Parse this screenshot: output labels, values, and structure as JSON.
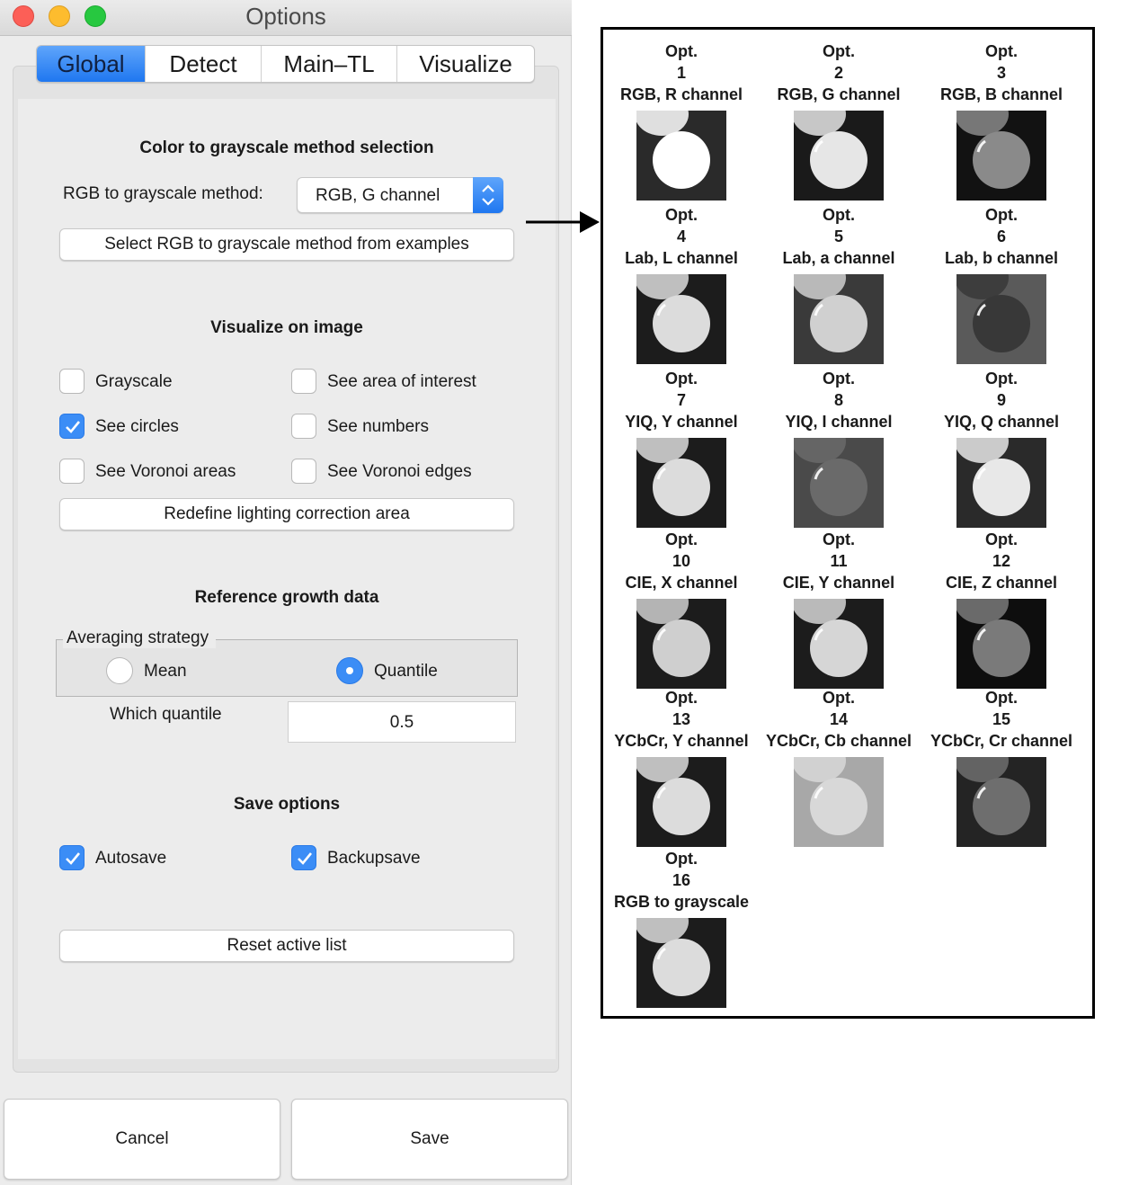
{
  "window": {
    "title": "Options",
    "tabs": [
      "Global",
      "Detect",
      "Main–TL",
      "Visualize"
    ],
    "active_tab": "Global"
  },
  "color_section": {
    "title": "Color to grayscale method selection",
    "method_label": "RGB to grayscale method:",
    "method_value": "RGB, G channel",
    "examples_button": "Select RGB to grayscale method from examples"
  },
  "visualize_section": {
    "title": "Visualize on image",
    "checkboxes": [
      {
        "label": "Grayscale",
        "checked": false
      },
      {
        "label": "See area of interest",
        "checked": false
      },
      {
        "label": "See circles",
        "checked": true
      },
      {
        "label": "See numbers",
        "checked": false
      },
      {
        "label": "See Voronoi areas",
        "checked": false
      },
      {
        "label": "See Voronoi edges",
        "checked": false
      }
    ],
    "lighting_button": "Redefine lighting correction area"
  },
  "reference_section": {
    "title": "Reference growth data",
    "group_label": "Averaging strategy",
    "radio_mean": "Mean",
    "radio_quantile": "Quantile",
    "selected": "Quantile",
    "quantile_label": "Which quantile",
    "quantile_value": "0.5"
  },
  "save_section": {
    "title": "Save options",
    "autosave": {
      "label": "Autosave",
      "checked": true
    },
    "backupsave": {
      "label": "Backupsave",
      "checked": true
    },
    "reset_button": "Reset active list"
  },
  "footer": {
    "cancel": "Cancel",
    "save": "Save"
  },
  "examples": [
    {
      "opt": "Opt.",
      "num": "1",
      "name": "RGB, R channel",
      "bg": "#2a2a2a",
      "fg": "#ffffff"
    },
    {
      "opt": "Opt.",
      "num": "2",
      "name": "RGB, G channel",
      "bg": "#1a1a1a",
      "fg": "#e6e6e6"
    },
    {
      "opt": "Opt.",
      "num": "3",
      "name": "RGB, B channel",
      "bg": "#121212",
      "fg": "#8a8a8a"
    },
    {
      "opt": "Opt.",
      "num": "4",
      "name": "Lab, L channel",
      "bg": "#1c1c1c",
      "fg": "#dcdcdc"
    },
    {
      "opt": "Opt.",
      "num": "5",
      "name": "Lab, a channel",
      "bg": "#3a3a3a",
      "fg": "#d0d0d0"
    },
    {
      "opt": "Opt.",
      "num": "6",
      "name": "Lab, b channel",
      "bg": "#5a5a5a",
      "fg": "#383838"
    },
    {
      "opt": "Opt.",
      "num": "7",
      "name": "YIQ, Y channel",
      "bg": "#1c1c1c",
      "fg": "#dcdcdc"
    },
    {
      "opt": "Opt.",
      "num": "8",
      "name": "YIQ, I channel",
      "bg": "#4a4a4a",
      "fg": "#6a6a6a"
    },
    {
      "opt": "Opt.",
      "num": "9",
      "name": "YIQ, Q channel",
      "bg": "#2a2a2a",
      "fg": "#e8e8e8"
    },
    {
      "opt": "Opt.",
      "num": "10",
      "name": "CIE, X channel",
      "bg": "#1c1c1c",
      "fg": "#cfcfcf"
    },
    {
      "opt": "Opt.",
      "num": "11",
      "name": "CIE, Y channel",
      "bg": "#1c1c1c",
      "fg": "#d6d6d6"
    },
    {
      "opt": "Opt.",
      "num": "12",
      "name": "CIE, Z channel",
      "bg": "#0e0e0e",
      "fg": "#7a7a7a"
    },
    {
      "opt": "Opt.",
      "num": "13",
      "name": "YCbCr, Y channel",
      "bg": "#1c1c1c",
      "fg": "#dcdcdc"
    },
    {
      "opt": "Opt.",
      "num": "14",
      "name": "YCbCr, Cb channel",
      "bg": "#a8a8a8",
      "fg": "#d8d8d8"
    },
    {
      "opt": "Opt.",
      "num": "15",
      "name": "YCbCr, Cr channel",
      "bg": "#242424",
      "fg": "#6e6e6e"
    },
    {
      "opt": "Opt.",
      "num": "16",
      "name": "RGB to grayscale",
      "bg": "#1c1c1c",
      "fg": "#dcdcdc"
    }
  ],
  "colors": {
    "accent": "#3b8df6",
    "window_bg": "#ececec"
  }
}
